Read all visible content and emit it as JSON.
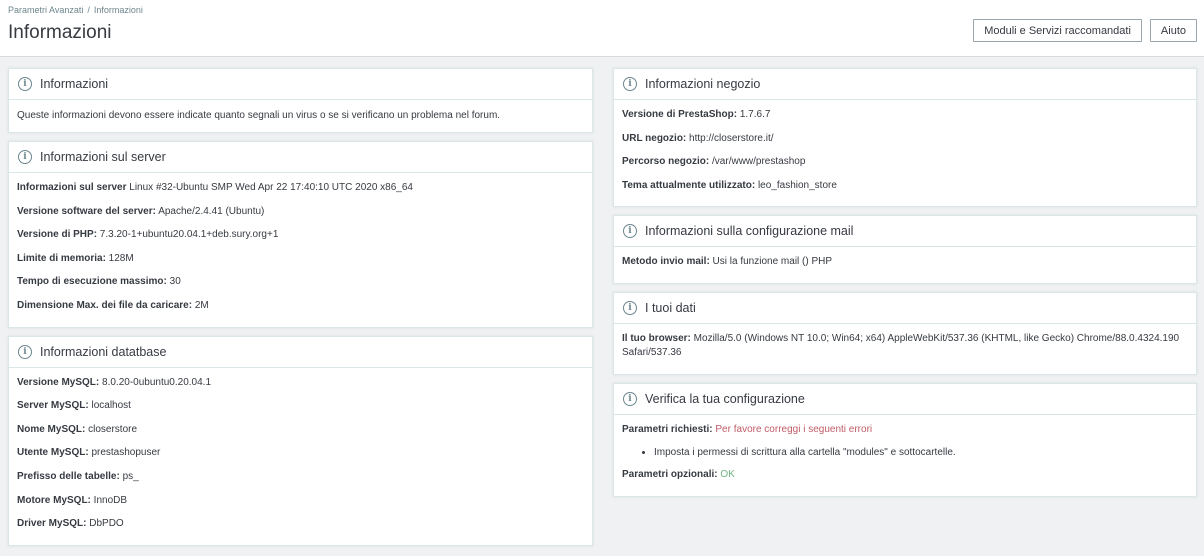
{
  "breadcrumb": {
    "parent": "Parametri Avanzati",
    "current": "Informazioni"
  },
  "page_title": "Informazioni",
  "toolbar": {
    "modules_button": "Moduli e Servizi raccomandati",
    "help_button": "Aiuto"
  },
  "cards": {
    "info": {
      "title": "Informazioni",
      "text": "Queste informazioni devono essere indicate quanto segnali un virus o se si verificano un problema nel forum."
    },
    "server": {
      "title": "Informazioni sul server",
      "rows": [
        {
          "label": "Informazioni sul server",
          "value": " Linux #32-Ubuntu SMP Wed Apr 22 17:40:10 UTC 2020 x86_64"
        },
        {
          "label": "Versione software del server:",
          "value": " Apache/2.4.41 (Ubuntu)"
        },
        {
          "label": "Versione di PHP:",
          "value": " 7.3.20-1+ubuntu20.04.1+deb.sury.org+1"
        },
        {
          "label": "Limite di memoria:",
          "value": " 128M"
        },
        {
          "label": "Tempo di esecuzione massimo:",
          "value": " 30"
        },
        {
          "label": "Dimensione Max. dei file da caricare:",
          "value": " 2M"
        }
      ]
    },
    "database": {
      "title": "Informazioni datatbase",
      "rows": [
        {
          "label": "Versione MySQL:",
          "value": " 8.0.20-0ubuntu0.20.04.1"
        },
        {
          "label": "Server MySQL:",
          "value": " localhost"
        },
        {
          "label": "Nome MySQL:",
          "value": " closerstore"
        },
        {
          "label": "Utente MySQL:",
          "value": " prestashopuser"
        },
        {
          "label": "Prefisso delle tabelle:",
          "value": " ps_"
        },
        {
          "label": "Motore MySQL:",
          "value": " InnoDB"
        },
        {
          "label": "Driver MySQL:",
          "value": " DbPDO"
        }
      ]
    },
    "shop": {
      "title": "Informazioni negozio",
      "rows": [
        {
          "label": "Versione di PrestaShop:",
          "value": " 1.7.6.7"
        },
        {
          "label": "URL negozio:",
          "value": " http://closerstore.it/"
        },
        {
          "label": "Percorso negozio:",
          "value": " /var/www/prestashop"
        },
        {
          "label": "Tema attualmente utilizzato:",
          "value": " leo_fashion_store"
        }
      ]
    },
    "mail": {
      "title": "Informazioni sulla configurazione mail",
      "rows": [
        {
          "label": "Metodo invio mail:",
          "value": " Usi la funzione mail () PHP"
        }
      ]
    },
    "your_data": {
      "title": "I tuoi dati",
      "rows": [
        {
          "label": "Il tuo browser:",
          "value": " Mozilla/5.0 (Windows NT 10.0; Win64; x64) AppleWebKit/537.36 (KHTML, like Gecko) Chrome/88.0.4324.190 Safari/537.36"
        }
      ]
    },
    "check": {
      "title": "Verifica la tua configurazione",
      "required_label": "Parametri richiesti:",
      "required_value": " Per favore correggi i seguenti errori",
      "errors": [
        "Imposta i permessi di scrittura alla cartella \"modules\" e sottocartelle."
      ],
      "optional_label": "Parametri opzionali:",
      "optional_value": " OK"
    }
  },
  "colors": {
    "error": "#c05c67",
    "ok": "#70b580",
    "background": "#eff1f2"
  },
  "icons": {
    "card_header": "info-circle-icon"
  }
}
